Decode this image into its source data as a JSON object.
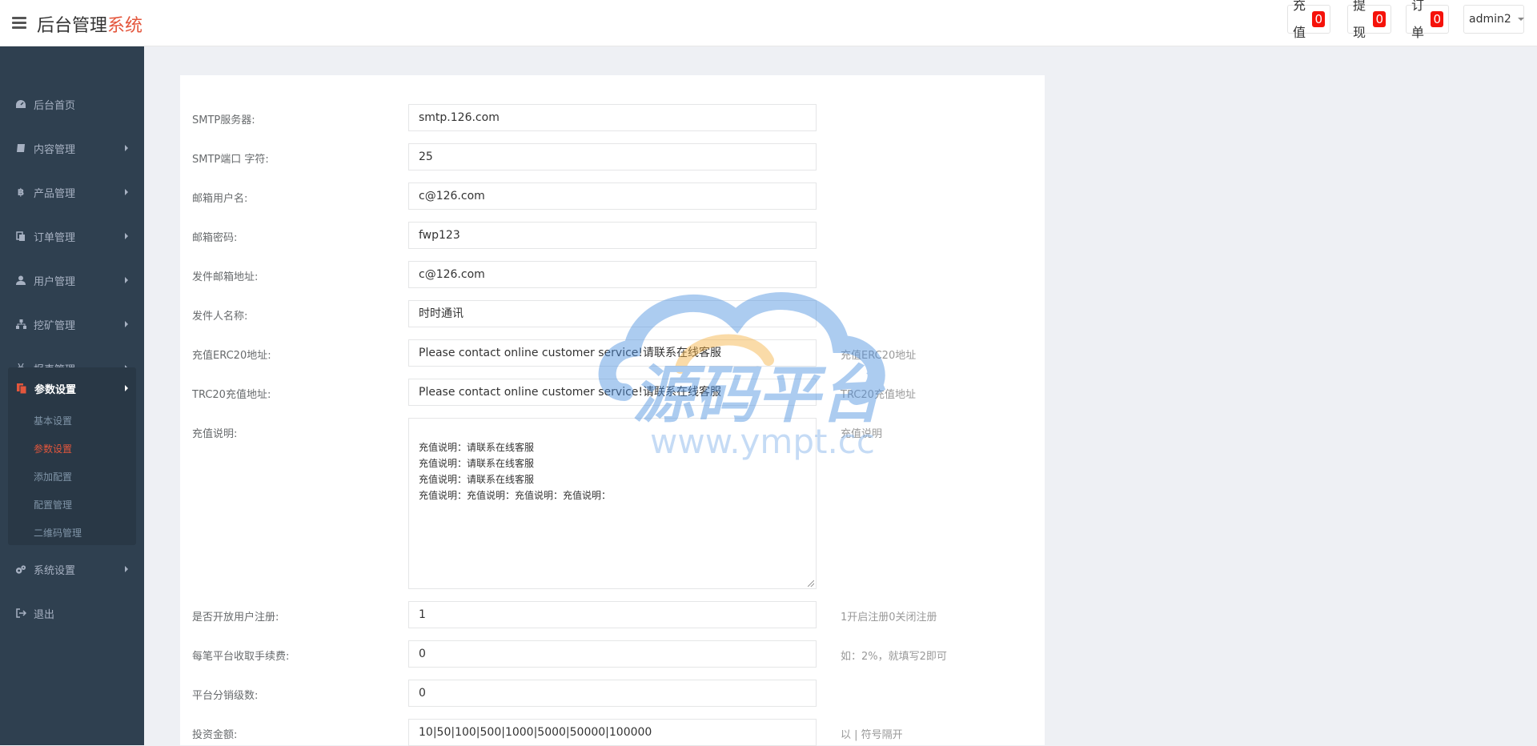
{
  "header": {
    "brand_main": "后台管理",
    "brand_accent": "系统",
    "recharge_label": "充值",
    "recharge_count": "0",
    "withdraw_label": "提现",
    "withdraw_count": "0",
    "orders_label": "订单",
    "orders_count": "0",
    "user": "admin2"
  },
  "sidebar": {
    "items": [
      {
        "label": "后台首页",
        "icon": "dashboard-icon"
      },
      {
        "label": "内容管理",
        "icon": "book-icon"
      },
      {
        "label": "产品管理",
        "icon": "bitcoin-icon"
      },
      {
        "label": "订单管理",
        "icon": "copy-icon"
      },
      {
        "label": "用户管理",
        "icon": "user-icon"
      },
      {
        "label": "挖矿管理",
        "icon": "sitemap-icon"
      },
      {
        "label": "报表管理",
        "icon": "yen-icon"
      },
      {
        "label": "参数设置",
        "icon": "files-icon"
      },
      {
        "label": "系统设置",
        "icon": "gears-icon"
      },
      {
        "label": "退出",
        "icon": "sign-out-icon"
      }
    ],
    "sub_items": [
      "基本设置",
      "参数设置",
      "添加配置",
      "配置管理",
      "二维码管理"
    ]
  },
  "form": {
    "smtp_server": {
      "label": "SMTP服务器:",
      "value": "smtp.126.com"
    },
    "smtp_port": {
      "label": "SMTP端口 字符:",
      "value": "25"
    },
    "mail_user": {
      "label": "邮箱用户名:",
      "value": "c@126.com"
    },
    "mail_pass": {
      "label": "邮箱密码:",
      "value": "fwp123"
    },
    "sender_addr": {
      "label": "发件邮箱地址:",
      "value": "c@126.com"
    },
    "sender_name": {
      "label": "发件人名称:",
      "value": "时时通讯"
    },
    "erc20": {
      "label": "充值ERC20地址:",
      "value": "Please contact online customer service!请联系在线客服",
      "hint": "充值ERC20地址"
    },
    "trc20": {
      "label": "TRC20充值地址:",
      "value": "Please contact online customer service!请联系在线客服",
      "hint": "TRC20充值地址"
    },
    "recharge_desc": {
      "label": "充值说明:",
      "value": "充值说明：请联系在线客服\n充值说明：请联系在线客服\n充值说明：请联系在线客服\n充值说明：充值说明：充值说明：充值说明：",
      "hint": "充值说明"
    },
    "open_register": {
      "label": "是否开放用户注册:",
      "value": "1",
      "hint": "1开启注册0关闭注册"
    },
    "fee": {
      "label": "每笔平台收取手续费:",
      "value": "0",
      "hint": "如：2%，就填写2即可"
    },
    "levels": {
      "label": "平台分销级数:",
      "value": "0"
    },
    "invest_amount": {
      "label": "投资金额:",
      "value": "10|50|100|500|1000|5000|50000|100000",
      "hint": "以 | 符号隔开"
    }
  },
  "watermark": {
    "text": "源码平台",
    "url": "www.ympt.cc",
    "color_blue": "#4a8fe0",
    "color_orange": "#f5b041"
  },
  "colors": {
    "sidebar_bg": "#2f4050",
    "accent": "#e4563c",
    "badge": "#f5120a"
  }
}
